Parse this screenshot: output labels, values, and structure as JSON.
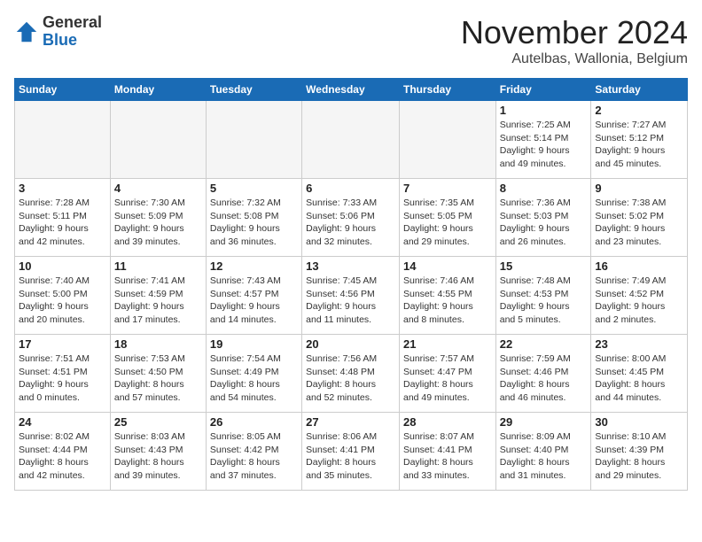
{
  "logo": {
    "general": "General",
    "blue": "Blue"
  },
  "header": {
    "month": "November 2024",
    "location": "Autelbas, Wallonia, Belgium"
  },
  "weekdays": [
    "Sunday",
    "Monday",
    "Tuesday",
    "Wednesday",
    "Thursday",
    "Friday",
    "Saturday"
  ],
  "weeks": [
    [
      {
        "day": "",
        "info": ""
      },
      {
        "day": "",
        "info": ""
      },
      {
        "day": "",
        "info": ""
      },
      {
        "day": "",
        "info": ""
      },
      {
        "day": "",
        "info": ""
      },
      {
        "day": "1",
        "info": "Sunrise: 7:25 AM\nSunset: 5:14 PM\nDaylight: 9 hours\nand 49 minutes."
      },
      {
        "day": "2",
        "info": "Sunrise: 7:27 AM\nSunset: 5:12 PM\nDaylight: 9 hours\nand 45 minutes."
      }
    ],
    [
      {
        "day": "3",
        "info": "Sunrise: 7:28 AM\nSunset: 5:11 PM\nDaylight: 9 hours\nand 42 minutes."
      },
      {
        "day": "4",
        "info": "Sunrise: 7:30 AM\nSunset: 5:09 PM\nDaylight: 9 hours\nand 39 minutes."
      },
      {
        "day": "5",
        "info": "Sunrise: 7:32 AM\nSunset: 5:08 PM\nDaylight: 9 hours\nand 36 minutes."
      },
      {
        "day": "6",
        "info": "Sunrise: 7:33 AM\nSunset: 5:06 PM\nDaylight: 9 hours\nand 32 minutes."
      },
      {
        "day": "7",
        "info": "Sunrise: 7:35 AM\nSunset: 5:05 PM\nDaylight: 9 hours\nand 29 minutes."
      },
      {
        "day": "8",
        "info": "Sunrise: 7:36 AM\nSunset: 5:03 PM\nDaylight: 9 hours\nand 26 minutes."
      },
      {
        "day": "9",
        "info": "Sunrise: 7:38 AM\nSunset: 5:02 PM\nDaylight: 9 hours\nand 23 minutes."
      }
    ],
    [
      {
        "day": "10",
        "info": "Sunrise: 7:40 AM\nSunset: 5:00 PM\nDaylight: 9 hours\nand 20 minutes."
      },
      {
        "day": "11",
        "info": "Sunrise: 7:41 AM\nSunset: 4:59 PM\nDaylight: 9 hours\nand 17 minutes."
      },
      {
        "day": "12",
        "info": "Sunrise: 7:43 AM\nSunset: 4:57 PM\nDaylight: 9 hours\nand 14 minutes."
      },
      {
        "day": "13",
        "info": "Sunrise: 7:45 AM\nSunset: 4:56 PM\nDaylight: 9 hours\nand 11 minutes."
      },
      {
        "day": "14",
        "info": "Sunrise: 7:46 AM\nSunset: 4:55 PM\nDaylight: 9 hours\nand 8 minutes."
      },
      {
        "day": "15",
        "info": "Sunrise: 7:48 AM\nSunset: 4:53 PM\nDaylight: 9 hours\nand 5 minutes."
      },
      {
        "day": "16",
        "info": "Sunrise: 7:49 AM\nSunset: 4:52 PM\nDaylight: 9 hours\nand 2 minutes."
      }
    ],
    [
      {
        "day": "17",
        "info": "Sunrise: 7:51 AM\nSunset: 4:51 PM\nDaylight: 9 hours\nand 0 minutes."
      },
      {
        "day": "18",
        "info": "Sunrise: 7:53 AM\nSunset: 4:50 PM\nDaylight: 8 hours\nand 57 minutes."
      },
      {
        "day": "19",
        "info": "Sunrise: 7:54 AM\nSunset: 4:49 PM\nDaylight: 8 hours\nand 54 minutes."
      },
      {
        "day": "20",
        "info": "Sunrise: 7:56 AM\nSunset: 4:48 PM\nDaylight: 8 hours\nand 52 minutes."
      },
      {
        "day": "21",
        "info": "Sunrise: 7:57 AM\nSunset: 4:47 PM\nDaylight: 8 hours\nand 49 minutes."
      },
      {
        "day": "22",
        "info": "Sunrise: 7:59 AM\nSunset: 4:46 PM\nDaylight: 8 hours\nand 46 minutes."
      },
      {
        "day": "23",
        "info": "Sunrise: 8:00 AM\nSunset: 4:45 PM\nDaylight: 8 hours\nand 44 minutes."
      }
    ],
    [
      {
        "day": "24",
        "info": "Sunrise: 8:02 AM\nSunset: 4:44 PM\nDaylight: 8 hours\nand 42 minutes."
      },
      {
        "day": "25",
        "info": "Sunrise: 8:03 AM\nSunset: 4:43 PM\nDaylight: 8 hours\nand 39 minutes."
      },
      {
        "day": "26",
        "info": "Sunrise: 8:05 AM\nSunset: 4:42 PM\nDaylight: 8 hours\nand 37 minutes."
      },
      {
        "day": "27",
        "info": "Sunrise: 8:06 AM\nSunset: 4:41 PM\nDaylight: 8 hours\nand 35 minutes."
      },
      {
        "day": "28",
        "info": "Sunrise: 8:07 AM\nSunset: 4:41 PM\nDaylight: 8 hours\nand 33 minutes."
      },
      {
        "day": "29",
        "info": "Sunrise: 8:09 AM\nSunset: 4:40 PM\nDaylight: 8 hours\nand 31 minutes."
      },
      {
        "day": "30",
        "info": "Sunrise: 8:10 AM\nSunset: 4:39 PM\nDaylight: 8 hours\nand 29 minutes."
      }
    ]
  ]
}
